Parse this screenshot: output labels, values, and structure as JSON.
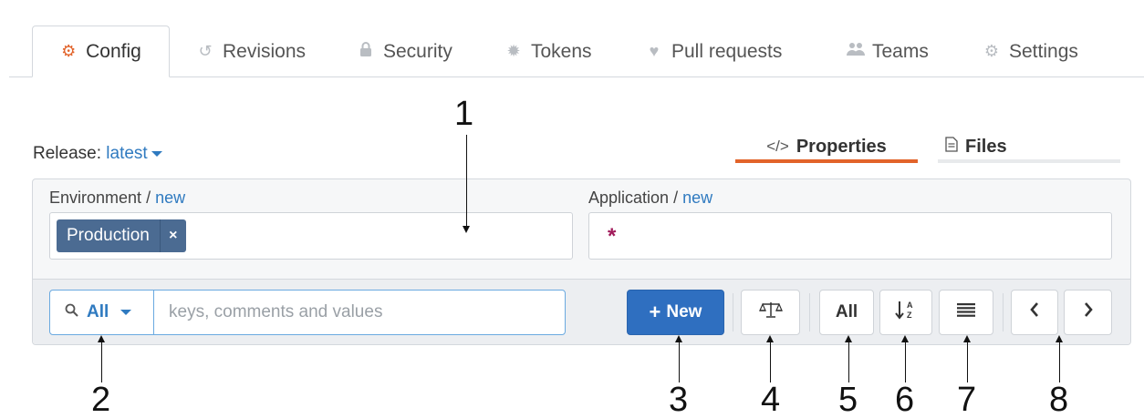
{
  "tabs": [
    {
      "label": "Config",
      "icon": "cogs-icon"
    },
    {
      "label": "Revisions",
      "icon": "history-icon"
    },
    {
      "label": "Security",
      "icon": "lock-icon"
    },
    {
      "label": "Tokens",
      "icon": "badge-icon"
    },
    {
      "label": "Pull requests",
      "icon": "heartbeat-icon"
    },
    {
      "label": "Teams",
      "icon": "users-icon"
    },
    {
      "label": "Settings",
      "icon": "gear-icon"
    }
  ],
  "active_tab": "Config",
  "release": {
    "label": "Release:",
    "value": "latest"
  },
  "view_tabs": {
    "properties": "Properties",
    "files": "Files"
  },
  "environment": {
    "label": "Environment",
    "separator": "/",
    "link": "new",
    "chip": "Production",
    "chip_remove": "×"
  },
  "application": {
    "label": "Application",
    "separator": "/",
    "link": "new",
    "value": "*"
  },
  "toolbar": {
    "search_scope": "All",
    "search_placeholder": "keys, comments and values",
    "new_label": "New",
    "new_icon": "+",
    "filter_all_label": "All",
    "compare_icon": "⚖",
    "sort_icon": "↓ᴬz",
    "list_icon": "≣",
    "prev_icon": "‹",
    "next_icon": "›"
  },
  "callouts": [
    "1",
    "2",
    "3",
    "4",
    "5",
    "6",
    "7",
    "8"
  ],
  "colors": {
    "accent": "#e2632a",
    "link": "#2f7ac0",
    "primary": "#2f6fc0",
    "chip": "#4b6b92",
    "star": "#a11a5a"
  }
}
